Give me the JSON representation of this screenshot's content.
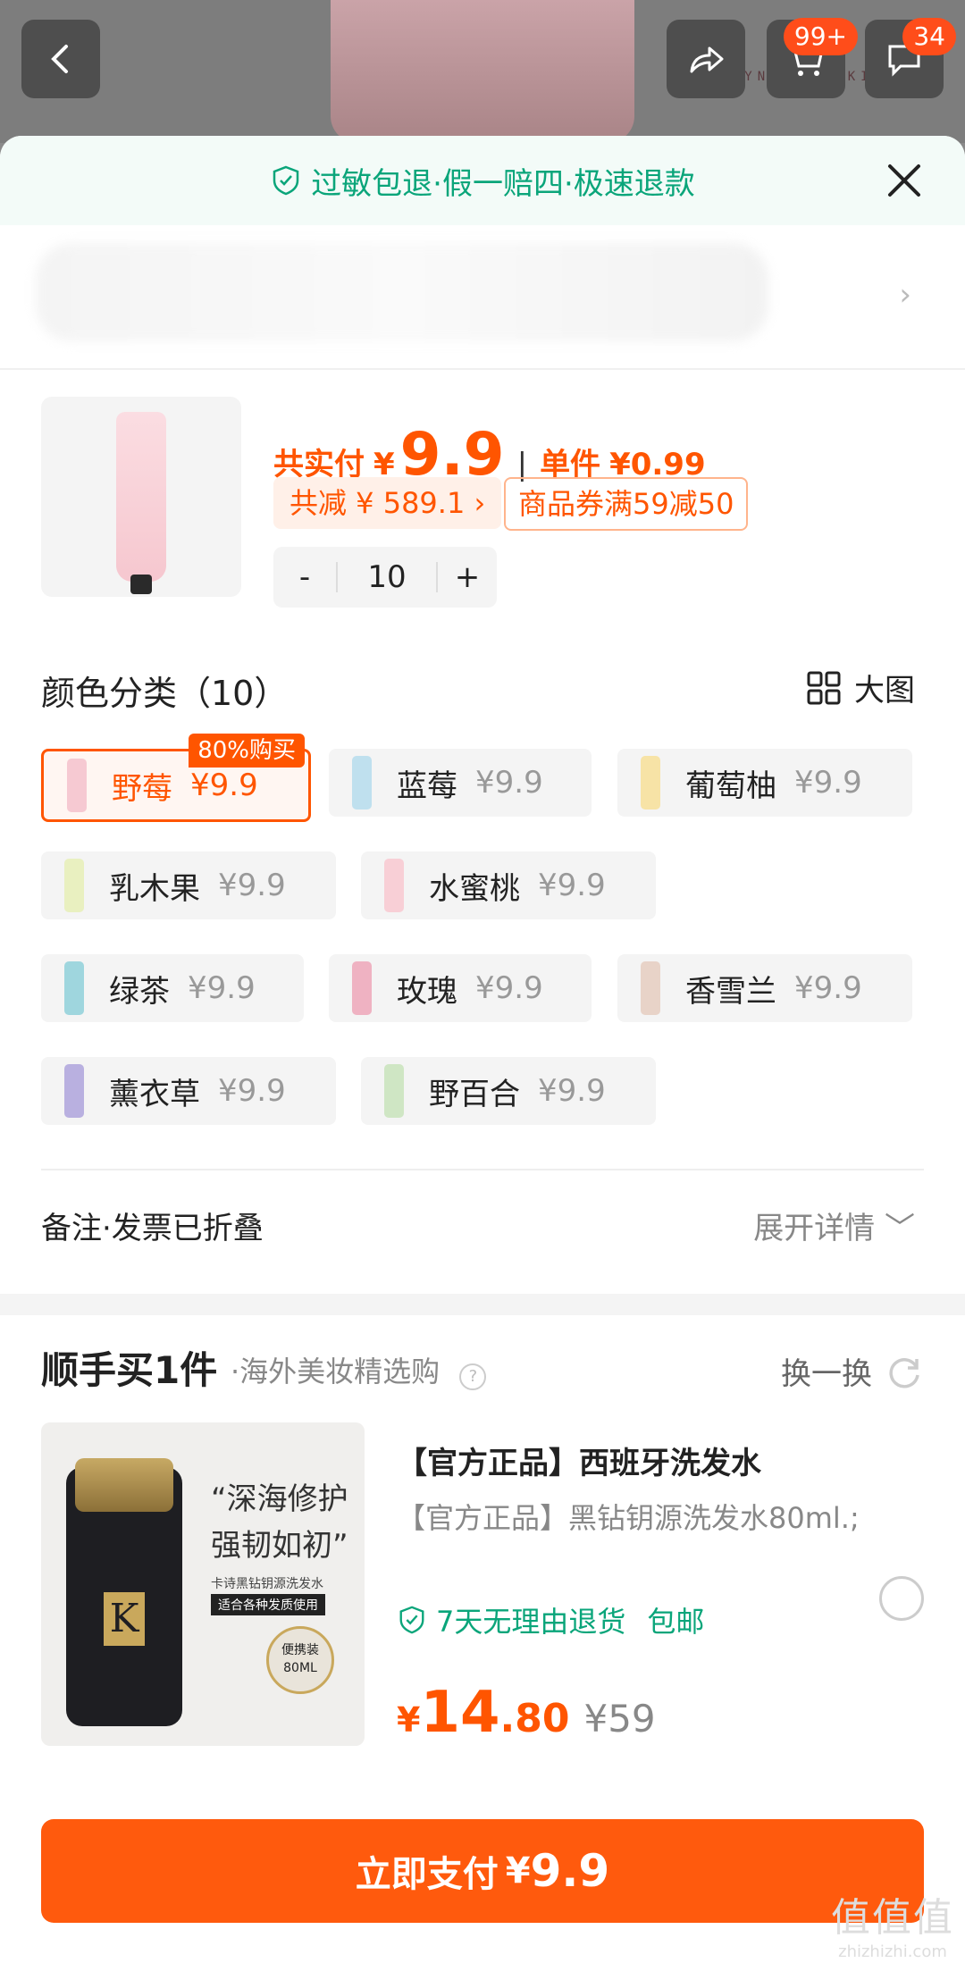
{
  "header": {
    "brand_text": "ERUYNBEAUTSKIN",
    "cart_badge": "99+",
    "message_badge": "34"
  },
  "sheet": {
    "guarantee": "过敏包退·假一赔四·极速退款",
    "address_chevron": "›"
  },
  "product": {
    "total_label": "共实付",
    "currency": "¥",
    "total_price": "9.9",
    "unit_label": "单件",
    "unit_price": "¥0.99",
    "discount_tag": "共减 ¥ 589.1 ›",
    "coupon_tag": "商品券满59减50",
    "qty_minus": "-",
    "qty_value": "10",
    "qty_plus": "+"
  },
  "options": {
    "title": "颜色分类（10）",
    "big_image_label": "大图",
    "hot_label": "80%购买",
    "items": [
      {
        "name": "野莓",
        "price": "¥9.9",
        "color": "#f6c9d2"
      },
      {
        "name": "蓝莓",
        "price": "¥9.9",
        "color": "#bfe0ee"
      },
      {
        "name": "葡萄柚",
        "price": "¥9.9",
        "color": "#f7e3a6"
      },
      {
        "name": "乳木果",
        "price": "¥9.9",
        "color": "#e9f0c0"
      },
      {
        "name": "水蜜桃",
        "price": "¥9.9",
        "color": "#f8cfd6"
      },
      {
        "name": "绿茶",
        "price": "¥9.9",
        "color": "#9fd6de"
      },
      {
        "name": "玫瑰",
        "price": "¥9.9",
        "color": "#efb2c2"
      },
      {
        "name": "香雪兰",
        "price": "¥9.9",
        "color": "#e8d3c8"
      },
      {
        "name": "薰衣草",
        "price": "¥9.9",
        "color": "#b9b0e0"
      },
      {
        "name": "野百合",
        "price": "¥9.9",
        "color": "#cfe6c4"
      }
    ]
  },
  "remark": {
    "label": "备注·发票已折叠",
    "expand": "展开详情 ﹀"
  },
  "recommend": {
    "title": "顺手买1件",
    "subtitle": "·海外美妆精选购",
    "swap_label": "换一换",
    "image_quote_1": "“深海修护",
    "image_quote_2": "强韧如初”",
    "image_small": "卡诗黑钻钥源洗发水",
    "image_pill": "适合各种发质使用",
    "image_seal": "便携装 80ML",
    "image_brand": "K",
    "item_title": "【官方正品】西班牙洗发水",
    "item_desc": "【官方正品】黑钻钥源洗发水80ml.;",
    "item_guarantee": "7天无理由退货",
    "item_shipping": "包邮",
    "currency": "¥",
    "price_int": "14",
    "price_dec": ".80",
    "price_orig": "¥59"
  },
  "pay": {
    "label": "立即支付",
    "currency": "¥",
    "amount": "9.9"
  },
  "watermark": {
    "line1": "值值值",
    "line2": "zhizhizhi.com"
  },
  "colors": {
    "accent": "#ff5500",
    "green": "#0aa57a"
  }
}
